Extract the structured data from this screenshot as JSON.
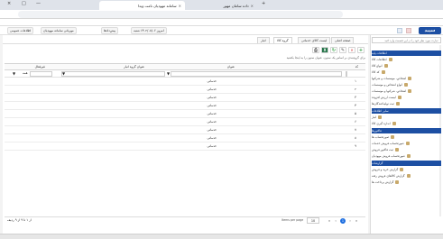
{
  "browser": {
    "tabs": [
      {
        "label": "سامانه مهودیان نامت ویدا"
      },
      {
        "label": "داده سامان مهور"
      }
    ],
    "new_tab_glyph": "+",
    "close_glyph": "×",
    "window_controls": [
      "—",
      "□",
      "×"
    ]
  },
  "appbar": {
    "logo": "سپید",
    "chips": [
      {
        "label": "اطلاعات عمومی"
      },
      {
        "label": "مهربانی سامانه مهودیان"
      },
      {
        "label": "پیش‌دادها"
      },
      {
        "label": "امروز ۱۴۰۲/۰۸/۰۶ شنبه"
      }
    ]
  },
  "sidebar": {
    "search_placeholder": "عبارت مورد نظر خود را در این قسمت وارد کنید",
    "sections": [
      {
        "title": "اطلاعات پایه",
        "items": [
          "اطلاعات کالا",
          "انواع کالا",
          "کد کالا",
          "اشخاص، موسسات و شرکتها",
          "انواع اشخاص و موسسات",
          "اشخاص، شرکتها و موسسات",
          "لیست ارزش افزوده",
          "ثبت تولیدکنندگان‌ها"
        ]
      },
      {
        "title": "سایر اطلاعات",
        "items": [
          "انبار",
          "اندازه گیری کالا"
        ]
      },
      {
        "title": "فاکتورها",
        "items": [
          "صورتحساب ها",
          "صورتحساب فروش خدمات",
          "ثبت فاکتور فروش",
          "صورتحساب فروش مهودیان"
        ]
      },
      {
        "title": "گزارشات",
        "items": [
          "گزارش خرید و فروش",
          "گزارش کالاهای فروش رفته",
          "گزارش پرداخت ها"
        ]
      }
    ]
  },
  "page_tabs": [
    {
      "label": "صفحه اصلی"
    },
    {
      "label": "لیست کالای خدماتی"
    },
    {
      "label": "گروه کالا"
    },
    {
      "label": "انبار"
    }
  ],
  "toolbar": {
    "add": "+",
    "delete": "✕",
    "edit": "✎",
    "refresh": "↻",
    "export_excel": "X",
    "print": "⎙"
  },
  "hint": "برای گروه‌بندی بر اساس یک ستون، عنوان ستون را به اینجا بکشید",
  "grid": {
    "columns": [
      {
        "header": "کد"
      },
      {
        "header": "عنوان"
      },
      {
        "header": "عنوان گروه انبار"
      },
      {
        "header": "غیرفعال"
      }
    ],
    "filter_glyph": "▼",
    "checkbox_filter": "همه",
    "rows": [
      {
        "code": "۱",
        "title": "خدماتی"
      },
      {
        "code": "۲",
        "title": "خدماتی"
      },
      {
        "code": "۳",
        "title": "خدماتی"
      },
      {
        "code": "۴",
        "title": "خدماتی"
      },
      {
        "code": "۵",
        "title": "خدماتی"
      },
      {
        "code": "۶",
        "title": "خدماتی"
      },
      {
        "code": "۷",
        "title": "خدماتی"
      },
      {
        "code": "۸",
        "title": "خدماتی"
      },
      {
        "code": "۹",
        "title": "خدماتی"
      }
    ]
  },
  "pager": {
    "summary": "از ۱ تا ۹ از ۹ ردیف",
    "current_page": "1",
    "items_per_page_label": "Items per page",
    "page_size": "10"
  },
  "colors": {
    "brand": "#1d4fa3",
    "accent": "#1f6fe0",
    "add": "#2e9e3e",
    "delete": "#d23a3a",
    "excel": "#217346"
  }
}
